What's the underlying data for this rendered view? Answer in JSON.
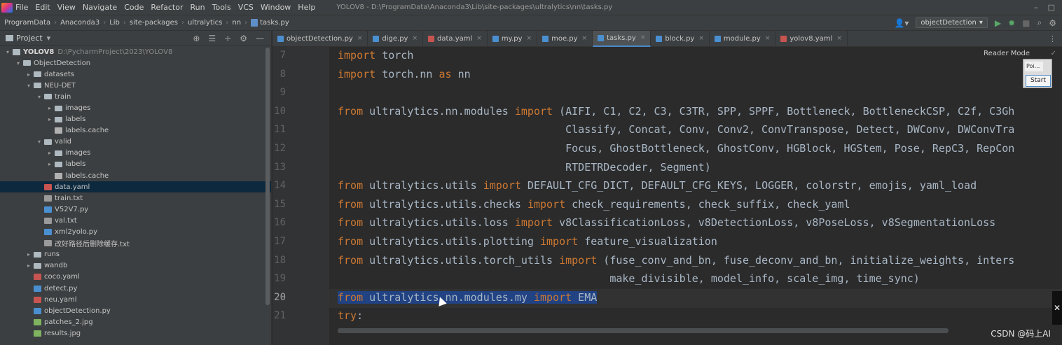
{
  "menubar": {
    "items": [
      "File",
      "Edit",
      "View",
      "Navigate",
      "Code",
      "Refactor",
      "Run",
      "Tools",
      "VCS",
      "Window",
      "Help"
    ],
    "title": "YOLOV8 - D:\\ProgramData\\Anaconda3\\Lib\\site-packages\\ultralytics\\nn\\tasks.py",
    "minimize": "–",
    "maximize": "□"
  },
  "navbar": {
    "crumbs": [
      "ProgramData",
      "Anaconda3",
      "Lib",
      "site-packages",
      "ultralytics",
      "nn",
      "tasks.py"
    ],
    "run_config": "objectDetection",
    "run_config_arrow": "▾",
    "user_icon": "👤▾",
    "play_icon": "▶",
    "debug_icon": "✹",
    "stop_icon": "■",
    "search_icon": "⌕",
    "settings_icon": "⚙"
  },
  "project": {
    "label": "Project",
    "dropdown": "▾",
    "tools": [
      "⊕",
      "☰",
      "÷",
      "⚙",
      "—"
    ],
    "tree": [
      {
        "name": "YOLOV8",
        "path": "D:\\PycharmProject\\2023\\YOLOV8",
        "indent": 0,
        "arrow": "▾",
        "icon": "root",
        "bold": true
      },
      {
        "name": "ObjectDetection",
        "indent": 1,
        "arrow": "▾",
        "icon": "folder"
      },
      {
        "name": "datasets",
        "indent": 2,
        "arrow": "▸",
        "icon": "folder"
      },
      {
        "name": "NEU-DET",
        "indent": 2,
        "arrow": "▾",
        "icon": "folder"
      },
      {
        "name": "train",
        "indent": 3,
        "arrow": "▾",
        "icon": "folder"
      },
      {
        "name": "images",
        "indent": 4,
        "arrow": "▸",
        "icon": "folder"
      },
      {
        "name": "labels",
        "indent": 4,
        "arrow": "▸",
        "icon": "folder"
      },
      {
        "name": "labels.cache",
        "indent": 4,
        "arrow": "",
        "icon": "cache"
      },
      {
        "name": "valid",
        "indent": 3,
        "arrow": "▾",
        "icon": "folder"
      },
      {
        "name": "images",
        "indent": 4,
        "arrow": "▸",
        "icon": "folder"
      },
      {
        "name": "labels",
        "indent": 4,
        "arrow": "▸",
        "icon": "folder"
      },
      {
        "name": "labels.cache",
        "indent": 4,
        "arrow": "",
        "icon": "cache"
      },
      {
        "name": "data.yaml",
        "indent": 3,
        "arrow": "",
        "icon": "yaml",
        "selected": true
      },
      {
        "name": "train.txt",
        "indent": 3,
        "arrow": "",
        "icon": "txt"
      },
      {
        "name": "V52V7.py",
        "indent": 3,
        "arrow": "",
        "icon": "py"
      },
      {
        "name": "val.txt",
        "indent": 3,
        "arrow": "",
        "icon": "txt"
      },
      {
        "name": "xml2yolo.py",
        "indent": 3,
        "arrow": "",
        "icon": "py"
      },
      {
        "name": "改好路径后删除缓存.txt",
        "indent": 3,
        "arrow": "",
        "icon": "txt"
      },
      {
        "name": "runs",
        "indent": 2,
        "arrow": "▸",
        "icon": "folder"
      },
      {
        "name": "wandb",
        "indent": 2,
        "arrow": "▸",
        "icon": "folder"
      },
      {
        "name": "coco.yaml",
        "indent": 2,
        "arrow": "",
        "icon": "yaml"
      },
      {
        "name": "detect.py",
        "indent": 2,
        "arrow": "",
        "icon": "py"
      },
      {
        "name": "neu.yaml",
        "indent": 2,
        "arrow": "",
        "icon": "yaml"
      },
      {
        "name": "objectDetection.py",
        "indent": 2,
        "arrow": "",
        "icon": "py"
      },
      {
        "name": "patches_2.jpg",
        "indent": 2,
        "arrow": "",
        "icon": "img"
      },
      {
        "name": "results.jpg",
        "indent": 2,
        "arrow": "",
        "icon": "img"
      }
    ]
  },
  "tabs": [
    {
      "label": "objectDetection.py",
      "icon": "py",
      "active": false
    },
    {
      "label": "dige.py",
      "icon": "py",
      "active": false
    },
    {
      "label": "data.yaml",
      "icon": "yaml",
      "active": false
    },
    {
      "label": "my.py",
      "icon": "py",
      "active": false
    },
    {
      "label": "moe.py",
      "icon": "py",
      "active": false
    },
    {
      "label": "tasks.py",
      "icon": "py",
      "active": true
    },
    {
      "label": "block.py",
      "icon": "py",
      "active": false
    },
    {
      "label": "module.py",
      "icon": "py",
      "active": false
    },
    {
      "label": "yolov8.yaml",
      "icon": "yaml",
      "active": false
    }
  ],
  "tabs_close": "×",
  "tabs_more": "⋮",
  "editor": {
    "reader_mode": "Reader Mode",
    "check_icon": "✓",
    "plugin": {
      "poi": "Poi...",
      "start": "Start"
    },
    "current_line": 20,
    "lines": [
      {
        "n": "7",
        "parts": [
          [
            "kw",
            "import"
          ],
          [
            "",
            " torch"
          ]
        ]
      },
      {
        "n": "8",
        "parts": [
          [
            "kw",
            "import"
          ],
          [
            "",
            " torch.nn "
          ],
          [
            "kw",
            "as"
          ],
          [
            "",
            " nn"
          ]
        ]
      },
      {
        "n": "9",
        "parts": []
      },
      {
        "n": "10",
        "parts": [
          [
            "kw",
            "from"
          ],
          [
            "",
            " ultralytics.nn.modules "
          ],
          [
            "kw",
            "import"
          ],
          [
            "",
            " (AIFI, C1, C2, C3, C3TR, SPP, SPPF, Bottleneck, BottleneckCSP, C2f, C3Gh"
          ]
        ]
      },
      {
        "n": "11",
        "parts": [
          [
            "",
            "                                    Classify, Concat, Conv, Conv2, ConvTranspose, Detect, DWConv, DWConvTra"
          ]
        ]
      },
      {
        "n": "12",
        "parts": [
          [
            "",
            "                                    Focus, GhostBottleneck, GhostConv, HGBlock, HGStem, Pose, RepC3, RepCon"
          ]
        ]
      },
      {
        "n": "13",
        "parts": [
          [
            "",
            "                                    RTDETRDecoder, Segment)"
          ]
        ]
      },
      {
        "n": "14",
        "parts": [
          [
            "kw",
            "from"
          ],
          [
            "",
            " ultralytics.utils "
          ],
          [
            "kw",
            "import"
          ],
          [
            "",
            " DEFAULT_CFG_DICT, DEFAULT_CFG_KEYS, LOGGER, colorstr, emojis, yaml_load"
          ]
        ]
      },
      {
        "n": "15",
        "parts": [
          [
            "kw",
            "from"
          ],
          [
            "",
            " ultralytics.utils.checks "
          ],
          [
            "kw",
            "import"
          ],
          [
            "",
            " check_requirements, check_suffix, check_yaml"
          ]
        ]
      },
      {
        "n": "16",
        "parts": [
          [
            "kw",
            "from"
          ],
          [
            "",
            " ultralytics.utils.loss "
          ],
          [
            "kw",
            "import"
          ],
          [
            "",
            " v8ClassificationLoss, v8DetectionLoss, v8PoseLoss, v8SegmentationLoss"
          ]
        ]
      },
      {
        "n": "17",
        "parts": [
          [
            "kw",
            "from"
          ],
          [
            "",
            " ultralytics.utils.plotting "
          ],
          [
            "kw",
            "import"
          ],
          [
            "",
            " feature_visualization"
          ]
        ]
      },
      {
        "n": "18",
        "parts": [
          [
            "kw",
            "from"
          ],
          [
            "",
            " ultralytics.utils.torch_utils "
          ],
          [
            "kw",
            "import"
          ],
          [
            "",
            " (fuse_conv_and_bn, fuse_deconv_and_bn, initialize_weights, inters"
          ]
        ]
      },
      {
        "n": "19",
        "parts": [
          [
            "",
            "                                           make_divisible, model_info, scale_img, time_sync)"
          ]
        ]
      },
      {
        "n": "20",
        "parts": [
          [
            "kw hl",
            "from"
          ],
          [
            "hl",
            " ultralytics.nn.modules.my "
          ],
          [
            "kw hl",
            "import"
          ],
          [
            "hl",
            " EMA"
          ]
        ]
      },
      {
        "n": "21",
        "parts": [
          [
            "kw",
            "try"
          ],
          [
            "",
            ":"
          ]
        ]
      }
    ]
  },
  "right_marker": "✕",
  "watermark": "CSDN @码上AI"
}
